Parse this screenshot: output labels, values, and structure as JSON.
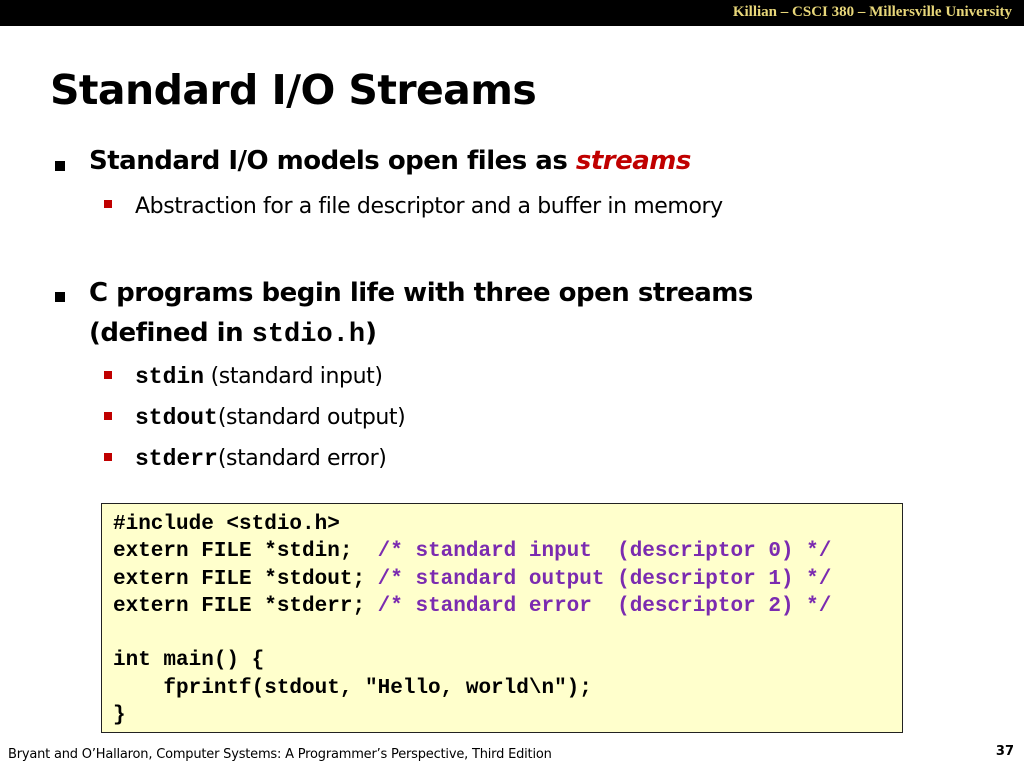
{
  "header": {
    "course": "Killian – CSCI 380 – Millersville University"
  },
  "title": "Standard I/O Streams",
  "bullets": [
    {
      "text_before": "Standard I/O models open files as ",
      "emphasis": "streams",
      "sub": [
        {
          "text": "Abstraction for a file descriptor and a buffer in memory"
        }
      ]
    },
    {
      "line1": "C programs begin life with three open streams",
      "line2_before": "(defined in ",
      "line2_code": "stdio.h",
      "line2_after": ")",
      "sub": [
        {
          "code": "stdin",
          "text": " (standard input)"
        },
        {
          "code": "stdout",
          "text": "(standard output)"
        },
        {
          "code": "stderr",
          "text": "(standard error)"
        }
      ]
    }
  ],
  "code": [
    {
      "code": "#include <stdio.h>",
      "comment": ""
    },
    {
      "code": "extern FILE *stdin;  ",
      "comment": "/* standard input  (descriptor 0) */"
    },
    {
      "code": "extern FILE *stdout; ",
      "comment": "/* standard output (descriptor 1) */"
    },
    {
      "code": "extern FILE *stderr; ",
      "comment": "/* standard error  (descriptor 2) */"
    },
    {
      "code": "",
      "comment": ""
    },
    {
      "code": "int main() {",
      "comment": ""
    },
    {
      "code": "    fprintf(stdout, \"Hello, world\\n\");",
      "comment": ""
    },
    {
      "code": "}",
      "comment": ""
    }
  ],
  "footer": {
    "citation": "Bryant and O’Hallaron, Computer Systems: A Programmer’s Perspective, Third Edition",
    "page": "37"
  },
  "colors": {
    "accent": "#c00000",
    "comment": "#7b2bb0",
    "code_bg": "#ffffcc",
    "header_text": "#e8d77a"
  }
}
